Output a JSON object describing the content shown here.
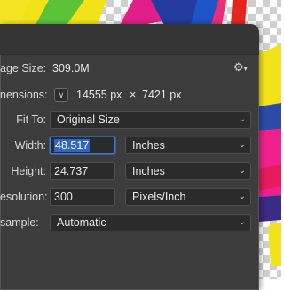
{
  "colors": {
    "dialog_bg": "#3c3c3c",
    "field_bg": "#2b2b2b",
    "focus_border": "#3f77c9",
    "selection": "#2f64c8"
  },
  "dialog": {
    "image_size_label": "age Size:",
    "image_size_value": "309.0M",
    "settings_icon": "gear-icon",
    "dimensions_label": "nensions:",
    "dimensions_width": "14555 px",
    "dimensions_times": "×",
    "dimensions_height": "7421 px",
    "fit_to_label": "Fit To:",
    "fit_to_value": "Original Size",
    "width_label": "Width:",
    "width_value": "48.517",
    "width_unit": "Inches",
    "height_label": "Height:",
    "height_value": "24.737",
    "height_unit": "Inches",
    "resolution_label": "esolution:",
    "resolution_value": "300",
    "resolution_unit": "Pixels/Inch",
    "resample_label": "sample:",
    "resample_value": "Automatic"
  }
}
